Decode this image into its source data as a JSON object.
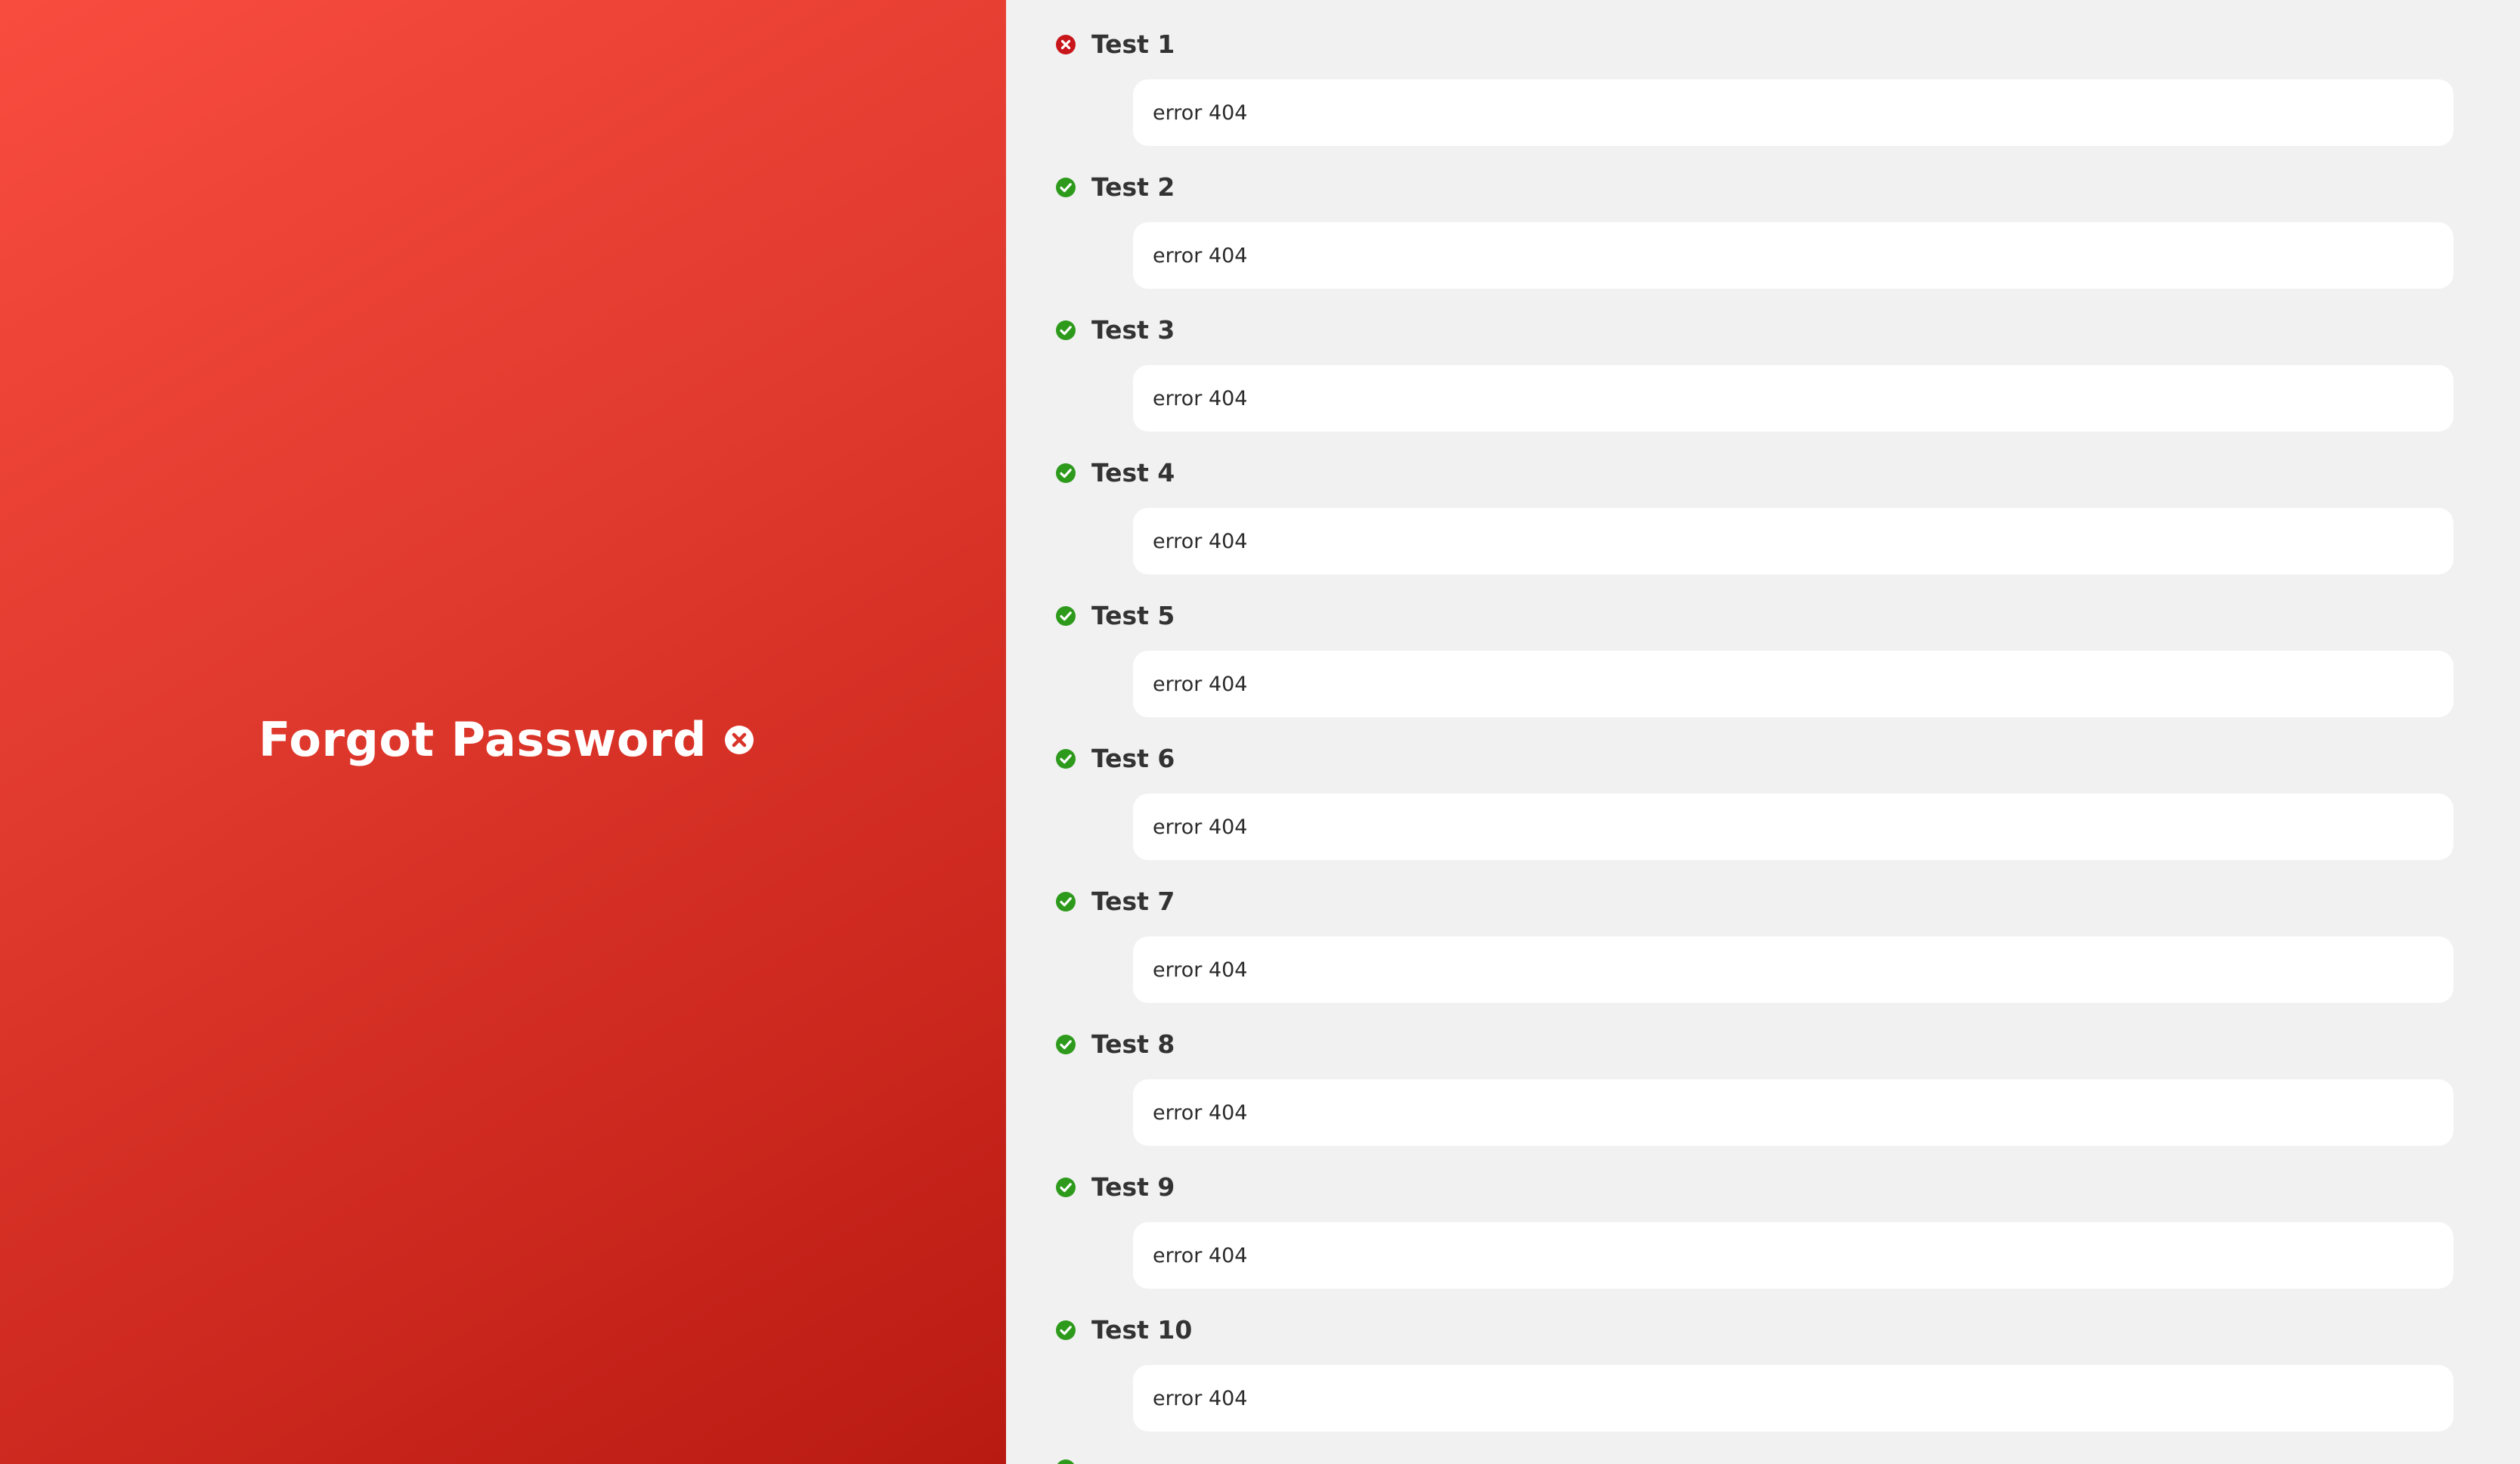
{
  "left_panel": {
    "title": "Forgot Password",
    "icon": "close-circle-icon",
    "gradient": [
      "#f84c3f",
      "#b81a12"
    ]
  },
  "tests": [
    {
      "name": "Test 1",
      "status": "fail",
      "value": "error 404"
    },
    {
      "name": "Test 2",
      "status": "pass",
      "value": "error 404"
    },
    {
      "name": "Test 3",
      "status": "pass",
      "value": "error 404"
    },
    {
      "name": "Test 4",
      "status": "pass",
      "value": "error 404"
    },
    {
      "name": "Test 5",
      "status": "pass",
      "value": "error 404"
    },
    {
      "name": "Test 6",
      "status": "pass",
      "value": "error 404"
    },
    {
      "name": "Test 7",
      "status": "pass",
      "value": "error 404"
    },
    {
      "name": "Test 8",
      "status": "pass",
      "value": "error 404"
    },
    {
      "name": "Test 9",
      "status": "pass",
      "value": "error 404"
    },
    {
      "name": "Test 10",
      "status": "pass",
      "value": "error 404"
    }
  ],
  "colors": {
    "pass": "#2e9a1c",
    "fail": "#c8161b",
    "background": "#f1f1f1",
    "field": "#ffffff"
  }
}
